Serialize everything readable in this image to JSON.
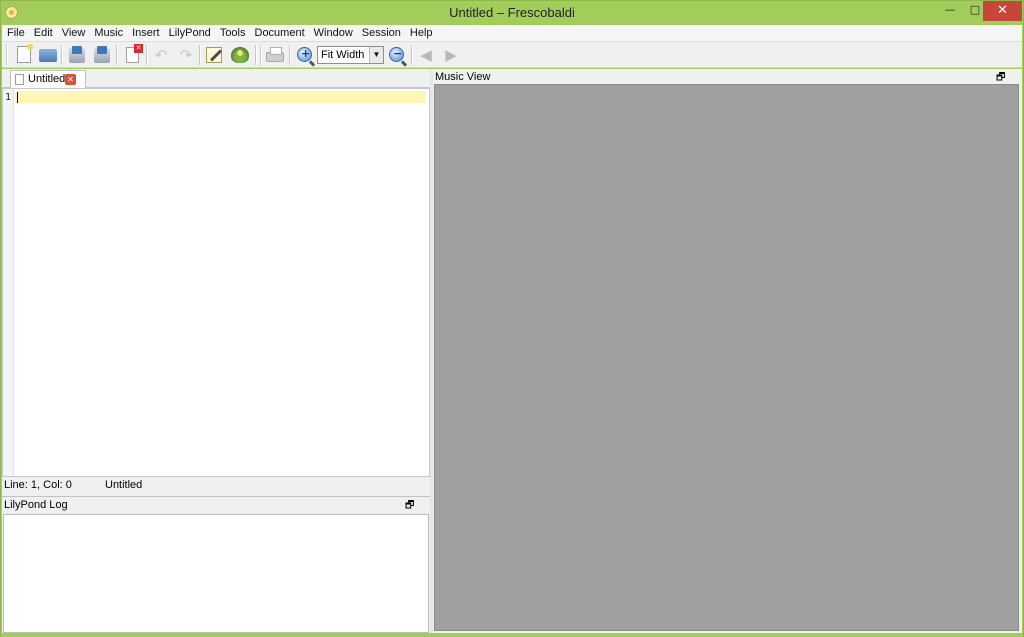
{
  "window": {
    "title": "Untitled – Frescobaldi",
    "minimize_glyph": "—",
    "maximize_glyph": "□",
    "close_glyph": "✕",
    "accent_color": "#a3cd5b",
    "close_color": "#c7463a"
  },
  "menu": {
    "items": [
      "File",
      "Edit",
      "View",
      "Music",
      "Insert",
      "LilyPond",
      "Tools",
      "Document",
      "Window",
      "Session",
      "Help"
    ]
  },
  "toolbar": {
    "icons": [
      "new-document-icon",
      "open-document-icon",
      "save-document-icon",
      "save-as-icon",
      "close-document-icon",
      "undo-icon",
      "redo-icon",
      "edit-icon",
      "lilypond-engrave-icon",
      "print-icon",
      "zoom-in-icon",
      "zoom-out-icon",
      "previous-page-icon",
      "next-page-icon"
    ],
    "zoom_in_glyph": "+",
    "zoom_out_glyph": "−",
    "undo_glyph": "↶",
    "redo_glyph": "↷",
    "prev_glyph": "◀",
    "next_glyph": "▶",
    "zoom_mode": "Fit Width",
    "dropdown_glyph": "▼"
  },
  "editor": {
    "tab_label": "Untitled",
    "tab_close_glyph": "✕",
    "line_number": "1",
    "current_line_color": "#fcf7b4"
  },
  "status": {
    "position": "Line: 1, Col: 0",
    "document": "Untitled"
  },
  "log": {
    "title": "LilyPond Log",
    "float_glyph": "🗗",
    "close_glyph": "✕"
  },
  "music_view": {
    "title": "Music View",
    "float_glyph": "🗗",
    "close_glyph": "✕",
    "canvas_color": "#a0a0a0"
  }
}
